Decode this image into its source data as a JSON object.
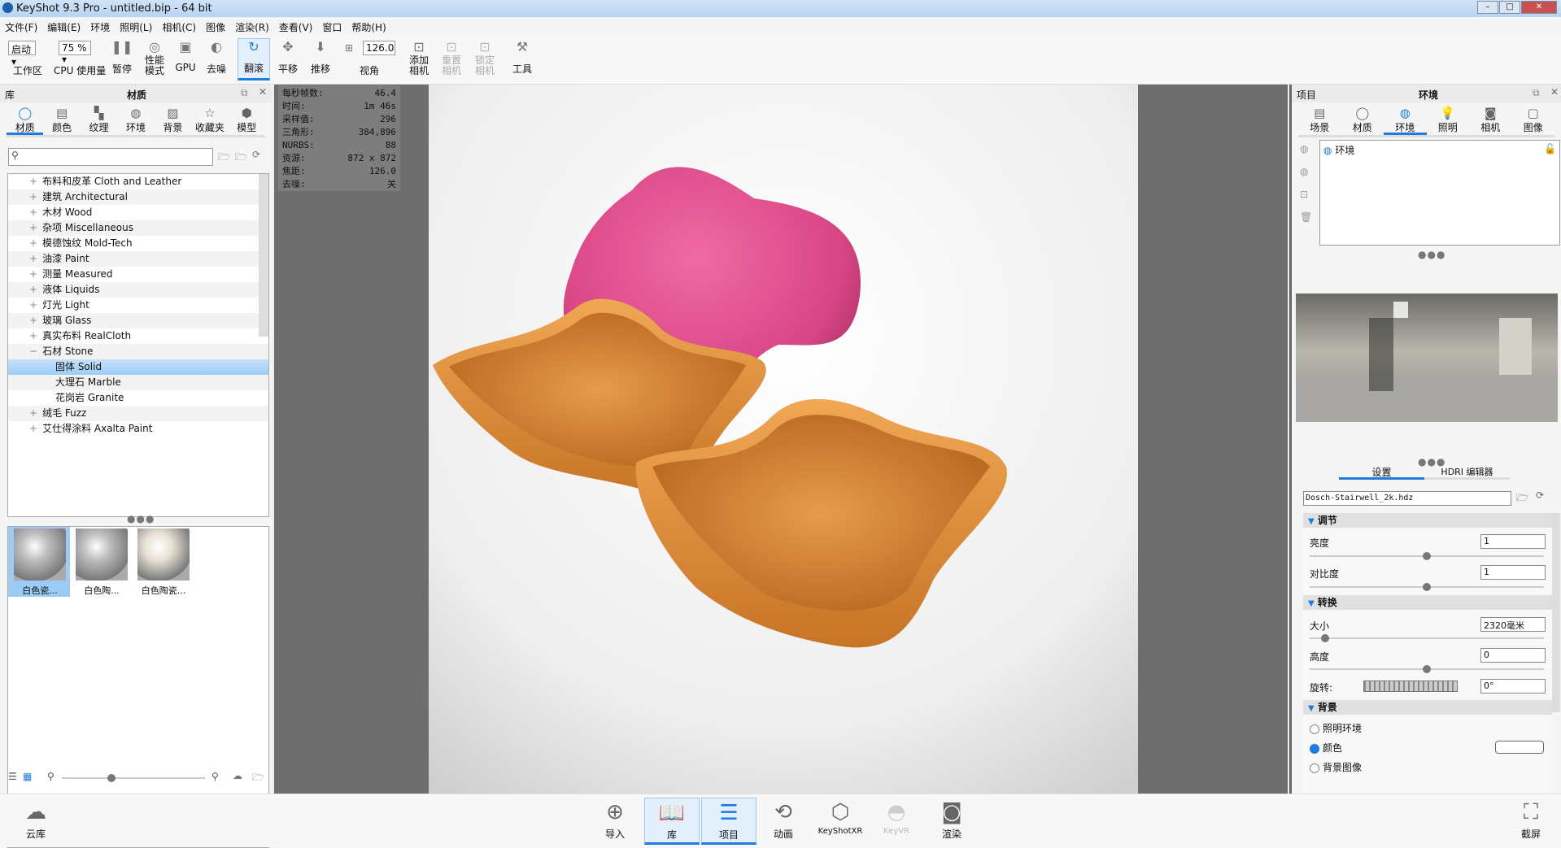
{
  "window": {
    "title": "KeyShot 9.3 Pro  - untitled.bip  - 64 bit",
    "min": "–",
    "max": "□",
    "close": "✕"
  },
  "menu": [
    "文件(F)",
    "编辑(E)",
    "环境",
    "照明(L)",
    "相机(C)",
    "图像",
    "渲染(R)",
    "查看(V)",
    "窗口",
    "帮助(H)"
  ],
  "toolbar": {
    "workspace_value": "启动",
    "workspace_label": "工作区",
    "cpu_value": "75 %",
    "cpu_label": "CPU 使用量",
    "pause": "暂停",
    "perf": "性能模式",
    "gpu": "GPU",
    "denoise": "去噪",
    "tumble": "翻滚",
    "pan": "平移",
    "dolly": "推移",
    "fov_value": "126.0",
    "fov_label": "视角",
    "add_camera": "添加相机",
    "reset_camera": "重置相机",
    "lock_camera": "锁定相机",
    "tools": "工具"
  },
  "library": {
    "title_left": "库",
    "title": "材质",
    "tabs": [
      "材质",
      "颜色",
      "纹理",
      "环境",
      "背景",
      "收藏夹",
      "模型"
    ],
    "search_placeholder": "",
    "tree": [
      {
        "label": "布料和皮革 Cloth and Leather",
        "exp": "+"
      },
      {
        "label": "建筑 Architectural",
        "exp": "+"
      },
      {
        "label": "木材 Wood",
        "exp": "+"
      },
      {
        "label": "杂项 Miscellaneous",
        "exp": "+"
      },
      {
        "label": "模德蚀纹 Mold-Tech",
        "exp": "+"
      },
      {
        "label": "油漆 Paint",
        "exp": "+"
      },
      {
        "label": "测量 Measured",
        "exp": "+"
      },
      {
        "label": "液体 Liquids",
        "exp": "+"
      },
      {
        "label": "灯光 Light",
        "exp": "+"
      },
      {
        "label": "玻璃 Glass",
        "exp": "+"
      },
      {
        "label": "真实布料 RealCloth",
        "exp": "+"
      },
      {
        "label": "石材 Stone",
        "exp": "−"
      },
      {
        "label": "固体 Solid",
        "exp": ""
      },
      {
        "label": "大理石 Marble",
        "exp": ""
      },
      {
        "label": "花岗岩 Granite",
        "exp": ""
      },
      {
        "label": "绒毛 Fuzz",
        "exp": "+"
      },
      {
        "label": "艾仕得涂料 Axalta Paint",
        "exp": "+"
      }
    ],
    "thumbs": [
      "白色瓷...",
      "白色陶...",
      "白色陶瓷..."
    ]
  },
  "stats": [
    [
      "每秒帧数:",
      "46.4"
    ],
    [
      "时间:",
      "1m 46s"
    ],
    [
      "采样值:",
      "296"
    ],
    [
      "三角形:",
      "384,896"
    ],
    [
      "NURBS:",
      "88"
    ],
    [
      "资源:",
      "872 x 872"
    ],
    [
      "焦距:",
      "126.0"
    ],
    [
      "去噪:",
      "关"
    ]
  ],
  "project": {
    "title_left": "项目",
    "title": "环境",
    "tabs": [
      "场景",
      "材质",
      "环境",
      "照明",
      "相机",
      "图像"
    ],
    "env_item": "环境",
    "subtabs": [
      "设置",
      "HDRI 编辑器"
    ],
    "hdri_file": "Dosch-Stairwell_2k.hdz",
    "adjust": {
      "title": "调节",
      "brightness_label": "亮度",
      "brightness": "1",
      "brightness_level": 0.5,
      "contrast_label": "对比度",
      "contrast": "1",
      "contrast_level": 0.5
    },
    "transform": {
      "title": "转换",
      "size_label": "大小",
      "size": "2320毫米",
      "size_level": 0.05,
      "height_label": "高度",
      "height": "0",
      "height_level": 0.5,
      "rotation_label": "旋转:",
      "rotation": "0°"
    },
    "background": {
      "title": "背景",
      "options": [
        "照明环境",
        "颜色",
        "背景图像"
      ],
      "selected": "颜色",
      "color": "#ffffff"
    }
  },
  "bottom": {
    "cloud": "云库",
    "import": "导入",
    "library": "库",
    "project": "项目",
    "animation": "动画",
    "keyshotxr": "KeyShotXR",
    "keyvr": "KeyVR",
    "render": "渲染",
    "screenshot": "截屏"
  },
  "colors": {
    "accent": "#1e7be0",
    "pink": "#e0528e",
    "orange": "#e79a45"
  }
}
